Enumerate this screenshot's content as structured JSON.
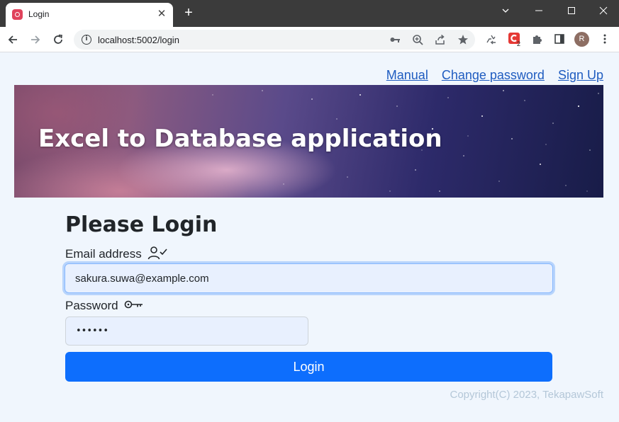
{
  "browser": {
    "tab_title": "Login",
    "tab_close": "✕",
    "new_tab": "+",
    "url": "localhost:5002/login",
    "extension_badge_count": "2",
    "profile_initial": "R"
  },
  "nav_links": {
    "manual": "Manual",
    "change_password": "Change password",
    "sign_up": "Sign Up"
  },
  "banner": {
    "title": "Excel to Database application"
  },
  "form": {
    "heading": "Please Login",
    "email_label": "Email address",
    "email_value": "sakura.suwa@example.com",
    "password_label": "Password",
    "password_value": "••••••",
    "login_label": "Login"
  },
  "footer": {
    "copyright": "Copyright(C) 2023, TekapawSoft"
  },
  "colors": {
    "page_background": "#f0f6fd",
    "link": "#1f5cc0",
    "primary_button": "#0d6efd",
    "input_background": "#e8f0fe",
    "copyright_text": "#b4c7d8"
  },
  "icons": [
    "user-check-icon",
    "key-icon",
    "info-icon",
    "key-saved-icon",
    "zoom-icon",
    "share-icon",
    "bookmark-star-icon",
    "recycle-icon",
    "extension-icon",
    "puzzle-icon",
    "side-panel-icon",
    "kebab-menu-icon"
  ]
}
